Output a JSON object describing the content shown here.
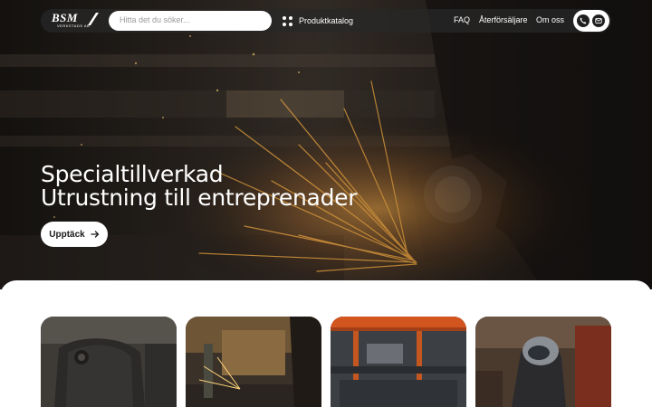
{
  "brand": {
    "name": "BSM",
    "subtitle": "VERKSTADS AB"
  },
  "search": {
    "placeholder": "Hitta det du söker..."
  },
  "nav": {
    "catalog_label": "Produktkatalog",
    "links": [
      "FAQ",
      "Återförsäljare",
      "Om oss"
    ]
  },
  "hero": {
    "headline_line1": "Specialtillverkad",
    "headline_line2": "Utrustning till entreprenader",
    "cta_label": "Upptäck"
  },
  "cards": [
    {
      "icon": "excavator-bucket-photo"
    },
    {
      "icon": "workshop-welding-photo"
    },
    {
      "icon": "steel-parts-rack-photo"
    },
    {
      "icon": "welder-with-mask-photo"
    }
  ],
  "colors": {
    "accent": "#ffffff",
    "navbar_bg": "#2b2b2b",
    "text_dark": "#1a1a1a"
  }
}
